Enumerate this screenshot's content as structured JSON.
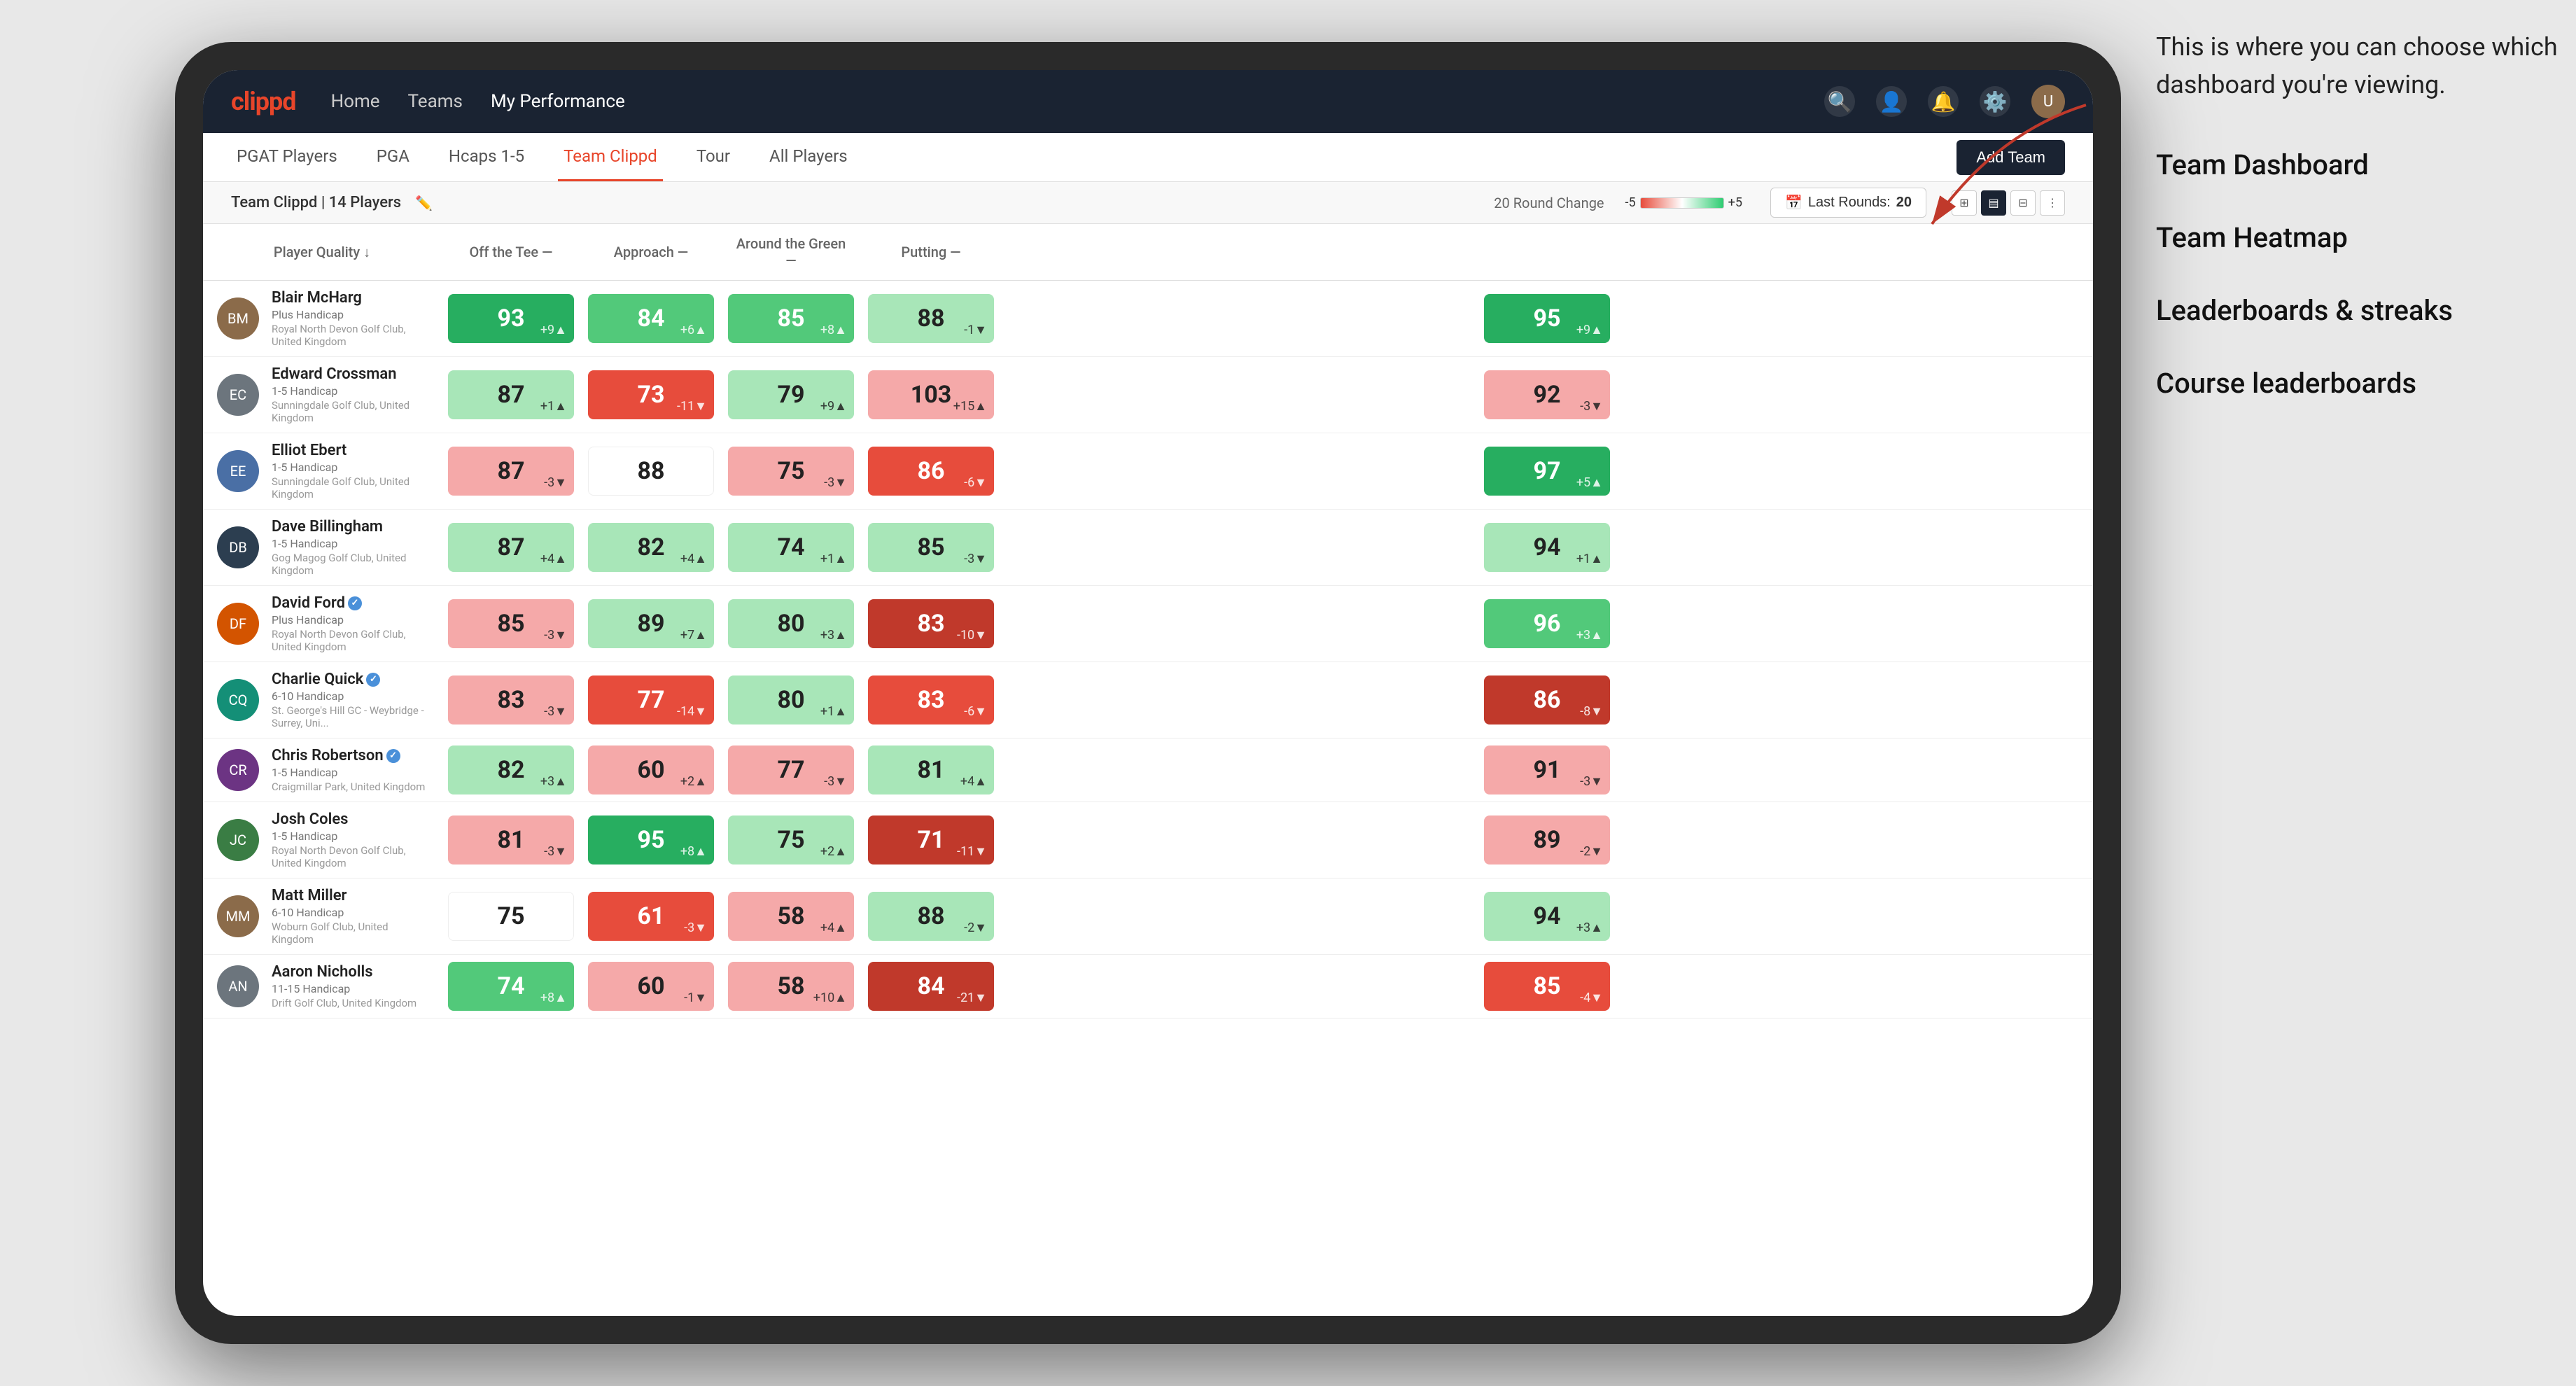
{
  "annotation": {
    "intro": "This is where you can choose which dashboard you're viewing.",
    "items": [
      "Team Dashboard",
      "Team Heatmap",
      "Leaderboards & streaks",
      "Course leaderboards"
    ]
  },
  "nav": {
    "logo": "clippd",
    "links": [
      "Home",
      "Teams",
      "My Performance"
    ],
    "active_link": "My Performance"
  },
  "sub_nav": {
    "tabs": [
      "PGAT Players",
      "PGA",
      "Hcaps 1-5",
      "Team Clippd",
      "Tour",
      "All Players"
    ],
    "active_tab": "Team Clippd",
    "add_team_label": "Add Team"
  },
  "team_header": {
    "team_name": "Team Clippd",
    "player_count": "14 Players",
    "round_change_label": "20 Round Change",
    "scale_min": "-5",
    "scale_max": "+5",
    "last_rounds_label": "Last Rounds:",
    "last_rounds_value": "20"
  },
  "table": {
    "columns": {
      "player": "Player Quality ↓",
      "off_tee": "Off the Tee —",
      "approach": "Approach —",
      "around_green": "Around the Green —",
      "putting": "Putting —"
    },
    "players": [
      {
        "name": "Blair McHarg",
        "handicap": "Plus Handicap",
        "club": "Royal North Devon Golf Club, United Kingdom",
        "avatar_color": "av-brown",
        "stats": {
          "quality": {
            "value": 93,
            "change": "+9",
            "direction": "up",
            "color": "bg-green-strong"
          },
          "off_tee": {
            "value": 84,
            "change": "+6",
            "direction": "up",
            "color": "bg-green-medium"
          },
          "approach": {
            "value": 85,
            "change": "+8",
            "direction": "up",
            "color": "bg-green-medium"
          },
          "around_green": {
            "value": 88,
            "change": "-1",
            "direction": "down",
            "color": "bg-green-light"
          },
          "putting": {
            "value": 95,
            "change": "+9",
            "direction": "up",
            "color": "bg-green-strong"
          }
        }
      },
      {
        "name": "Edward Crossman",
        "handicap": "1-5 Handicap",
        "club": "Sunningdale Golf Club, United Kingdom",
        "avatar_color": "av-gray",
        "stats": {
          "quality": {
            "value": 87,
            "change": "+1",
            "direction": "up",
            "color": "bg-green-light"
          },
          "off_tee": {
            "value": 73,
            "change": "-11",
            "direction": "down",
            "color": "bg-red-medium"
          },
          "approach": {
            "value": 79,
            "change": "+9",
            "direction": "up",
            "color": "bg-green-light"
          },
          "around_green": {
            "value": 103,
            "change": "+15",
            "direction": "up",
            "color": "bg-red-light"
          },
          "putting": {
            "value": 92,
            "change": "-3",
            "direction": "down",
            "color": "bg-red-light"
          }
        }
      },
      {
        "name": "Elliot Ebert",
        "handicap": "1-5 Handicap",
        "club": "Sunningdale Golf Club, United Kingdom",
        "avatar_color": "av-blue",
        "stats": {
          "quality": {
            "value": 87,
            "change": "-3",
            "direction": "down",
            "color": "bg-red-light"
          },
          "off_tee": {
            "value": 88,
            "change": "",
            "direction": "",
            "color": "bg-white"
          },
          "approach": {
            "value": 75,
            "change": "-3",
            "direction": "down",
            "color": "bg-red-light"
          },
          "around_green": {
            "value": 86,
            "change": "-6",
            "direction": "down",
            "color": "bg-red-medium"
          },
          "putting": {
            "value": 97,
            "change": "+5",
            "direction": "up",
            "color": "bg-green-strong"
          }
        }
      },
      {
        "name": "Dave Billingham",
        "handicap": "1-5 Handicap",
        "club": "Gog Magog Golf Club, United Kingdom",
        "avatar_color": "av-navy",
        "stats": {
          "quality": {
            "value": 87,
            "change": "+4",
            "direction": "up",
            "color": "bg-green-light"
          },
          "off_tee": {
            "value": 82,
            "change": "+4",
            "direction": "up",
            "color": "bg-green-light"
          },
          "approach": {
            "value": 74,
            "change": "+1",
            "direction": "up",
            "color": "bg-green-light"
          },
          "around_green": {
            "value": 85,
            "change": "-3",
            "direction": "down",
            "color": "bg-green-light"
          },
          "putting": {
            "value": 94,
            "change": "+1",
            "direction": "up",
            "color": "bg-green-light"
          }
        }
      },
      {
        "name": "David Ford",
        "handicap": "Plus Handicap",
        "club": "Royal North Devon Golf Club, United Kingdom",
        "avatar_color": "av-orange",
        "verified": true,
        "stats": {
          "quality": {
            "value": 85,
            "change": "-3",
            "direction": "down",
            "color": "bg-red-light"
          },
          "off_tee": {
            "value": 89,
            "change": "+7",
            "direction": "up",
            "color": "bg-green-light"
          },
          "approach": {
            "value": 80,
            "change": "+3",
            "direction": "up",
            "color": "bg-green-light"
          },
          "around_green": {
            "value": 83,
            "change": "-10",
            "direction": "down",
            "color": "bg-red-strong"
          },
          "putting": {
            "value": 96,
            "change": "+3",
            "direction": "up",
            "color": "bg-green-medium"
          }
        }
      },
      {
        "name": "Charlie Quick",
        "handicap": "6-10 Handicap",
        "club": "St. George's Hill GC - Weybridge - Surrey, Uni...",
        "avatar_color": "av-teal",
        "verified": true,
        "stats": {
          "quality": {
            "value": 83,
            "change": "-3",
            "direction": "down",
            "color": "bg-red-light"
          },
          "off_tee": {
            "value": 77,
            "change": "-14",
            "direction": "down",
            "color": "bg-red-medium"
          },
          "approach": {
            "value": 80,
            "change": "+1",
            "direction": "up",
            "color": "bg-green-light"
          },
          "around_green": {
            "value": 83,
            "change": "-6",
            "direction": "down",
            "color": "bg-red-medium"
          },
          "putting": {
            "value": 86,
            "change": "-8",
            "direction": "down",
            "color": "bg-red-strong"
          }
        }
      },
      {
        "name": "Chris Robertson",
        "handicap": "1-5 Handicap",
        "club": "Craigmillar Park, United Kingdom",
        "avatar_color": "av-purple",
        "verified": true,
        "stats": {
          "quality": {
            "value": 82,
            "change": "+3",
            "direction": "up",
            "color": "bg-green-light"
          },
          "off_tee": {
            "value": 60,
            "change": "+2",
            "direction": "up",
            "color": "bg-red-light"
          },
          "approach": {
            "value": 77,
            "change": "-3",
            "direction": "down",
            "color": "bg-red-light"
          },
          "around_green": {
            "value": 81,
            "change": "+4",
            "direction": "up",
            "color": "bg-green-light"
          },
          "putting": {
            "value": 91,
            "change": "-3",
            "direction": "down",
            "color": "bg-red-light"
          }
        }
      },
      {
        "name": "Josh Coles",
        "handicap": "1-5 Handicap",
        "club": "Royal North Devon Golf Club, United Kingdom",
        "avatar_color": "av-green",
        "stats": {
          "quality": {
            "value": 81,
            "change": "-3",
            "direction": "down",
            "color": "bg-red-light"
          },
          "off_tee": {
            "value": 95,
            "change": "+8",
            "direction": "up",
            "color": "bg-green-strong"
          },
          "approach": {
            "value": 75,
            "change": "+2",
            "direction": "up",
            "color": "bg-green-light"
          },
          "around_green": {
            "value": 71,
            "change": "-11",
            "direction": "down",
            "color": "bg-red-strong"
          },
          "putting": {
            "value": 89,
            "change": "-2",
            "direction": "down",
            "color": "bg-red-light"
          }
        }
      },
      {
        "name": "Matt Miller",
        "handicap": "6-10 Handicap",
        "club": "Woburn Golf Club, United Kingdom",
        "avatar_color": "av-brown",
        "stats": {
          "quality": {
            "value": 75,
            "change": "",
            "direction": "",
            "color": "bg-white"
          },
          "off_tee": {
            "value": 61,
            "change": "-3",
            "direction": "down",
            "color": "bg-red-medium"
          },
          "approach": {
            "value": 58,
            "change": "+4",
            "direction": "up",
            "color": "bg-red-light"
          },
          "around_green": {
            "value": 88,
            "change": "-2",
            "direction": "down",
            "color": "bg-green-light"
          },
          "putting": {
            "value": 94,
            "change": "+3",
            "direction": "up",
            "color": "bg-green-light"
          }
        }
      },
      {
        "name": "Aaron Nicholls",
        "handicap": "11-15 Handicap",
        "club": "Drift Golf Club, United Kingdom",
        "avatar_color": "av-gray",
        "stats": {
          "quality": {
            "value": 74,
            "change": "+8",
            "direction": "up",
            "color": "bg-green-medium"
          },
          "off_tee": {
            "value": 60,
            "change": "-1",
            "direction": "down",
            "color": "bg-red-light"
          },
          "approach": {
            "value": 58,
            "change": "+10",
            "direction": "up",
            "color": "bg-red-light"
          },
          "around_green": {
            "value": 84,
            "change": "-21",
            "direction": "down",
            "color": "bg-red-strong"
          },
          "putting": {
            "value": 85,
            "change": "-4",
            "direction": "down",
            "color": "bg-red-medium"
          }
        }
      }
    ]
  }
}
